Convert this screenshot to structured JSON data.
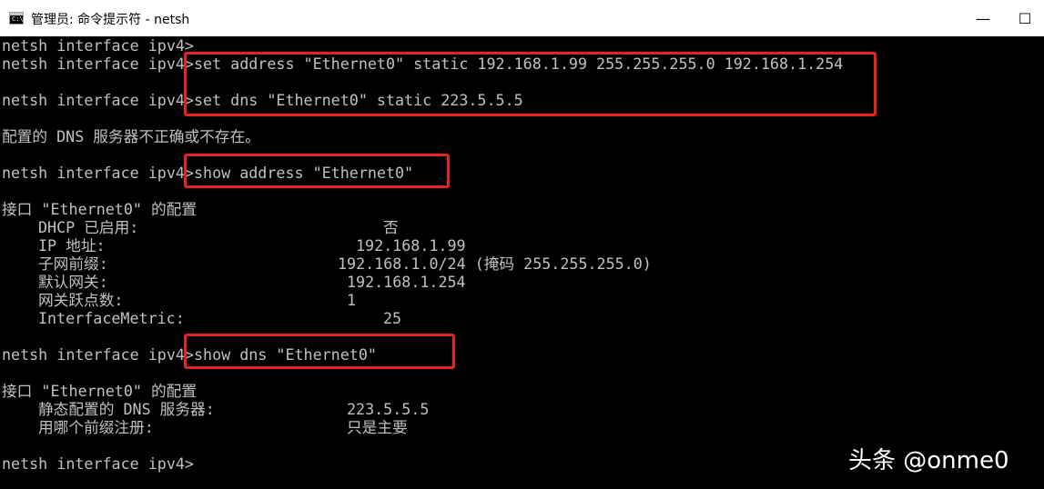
{
  "window": {
    "title": "管理员: 命令提示符 - netsh",
    "icon_text": "C:\\.",
    "minimize_glyph": "—",
    "maximize_glyph": "☐"
  },
  "console": {
    "prompt": "netsh interface ipv4>",
    "commands": {
      "set_address": "set address \"Ethernet0\" static 192.168.1.99 255.255.255.0 192.168.1.254",
      "set_dns": "set dns \"Ethernet0\" static 223.5.5.5",
      "show_address": "show address \"Ethernet0\"",
      "show_dns": "show dns \"Ethernet0\""
    },
    "dns_error": "配置的 DNS 服务器不正确或不存在。",
    "address_section": {
      "header": "接口 \"Ethernet0\" 的配置",
      "rows": [
        {
          "label": "DHCP 已启用:",
          "value": "否"
        },
        {
          "label": "IP 地址:",
          "value": "192.168.1.99"
        },
        {
          "label": "子网前缀:",
          "value": "192.168.1.0/24 (掩码 255.255.255.0)"
        },
        {
          "label": "默认网关:",
          "value": "192.168.1.254"
        },
        {
          "label": "网关跃点数:",
          "value": "1"
        },
        {
          "label": "InterfaceMetric:",
          "value": "25"
        }
      ]
    },
    "dns_section": {
      "header": "接口 \"Ethernet0\" 的配置",
      "rows": [
        {
          "label": "静态配置的 DNS 服务器:",
          "value": "223.5.5.5"
        },
        {
          "label": "用哪个前缀注册:",
          "value": "只是主要"
        }
      ]
    }
  },
  "watermark": "头条 @onme0",
  "colors": {
    "console_bg": "#000000",
    "console_text": "#c0c0c0",
    "highlight_box": "#e8211e",
    "titlebar_bg": "#ffffff"
  }
}
